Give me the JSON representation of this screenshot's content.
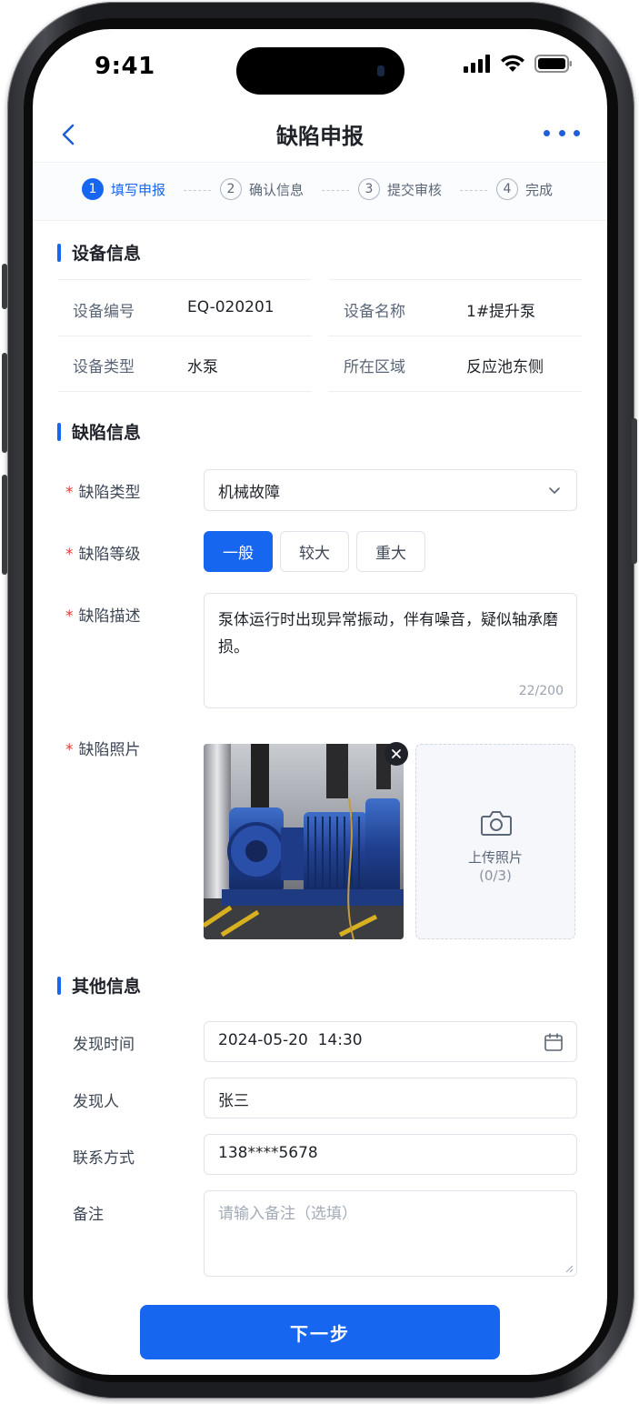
{
  "status_bar": {
    "time": "9:41"
  },
  "nav": {
    "title": "缺陷申报"
  },
  "steps": [
    {
      "num": "1",
      "label": "填写申报"
    },
    {
      "num": "2",
      "label": "确认信息"
    },
    {
      "num": "3",
      "label": "提交审核"
    },
    {
      "num": "4",
      "label": "完成"
    }
  ],
  "device_section": {
    "title": "设备信息",
    "fields": [
      {
        "label": "设备编号",
        "value": "EQ-020201"
      },
      {
        "label": "设备名称",
        "value": "1#提升泵"
      },
      {
        "label": "设备类型",
        "value": "水泵"
      },
      {
        "label": "所在区域",
        "value": "反应池东侧"
      }
    ]
  },
  "defect_section": {
    "title": "缺陷信息",
    "required_mark": "*",
    "type_label": "缺陷类型",
    "type_value": "机械故障",
    "level_label": "缺陷等级",
    "levels": [
      "一般",
      "较大",
      "重大"
    ],
    "desc_label": "缺陷描述",
    "desc_value": "泵体运行时出现异常振动，伴有噪音，疑似轴承磨损。",
    "desc_count": "22/200",
    "photo_label": "缺陷照片",
    "upload_label": "上传照片",
    "upload_count": "(0/3)"
  },
  "other_section": {
    "title": "其他信息",
    "time_label": "发现时间",
    "time_value": "2024-05-20  14:30",
    "finder_label": "发现人",
    "finder_value": "张三",
    "contact_label": "联系方式",
    "contact_value": "138****5678",
    "remark_label": "备注",
    "remark_placeholder": "请输入备注（选填）"
  },
  "next_button": "下一步",
  "colors": {
    "primary": "#1766f0",
    "required": "#e53935"
  }
}
